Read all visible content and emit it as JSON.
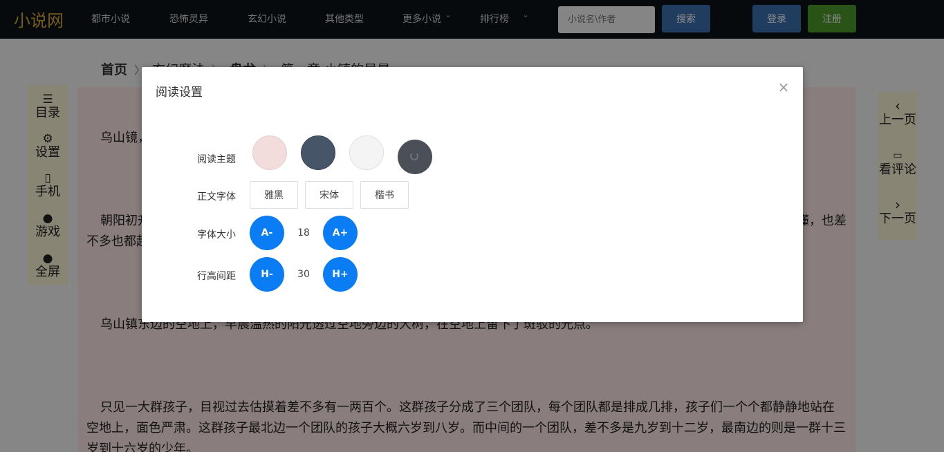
{
  "nav": {
    "logo": "小说网",
    "items": [
      "都市小说",
      "恐怖灵异",
      "玄幻小说",
      "其他类型",
      "更多小说",
      "排行榜"
    ],
    "search_placeholder": "小说名\\作者",
    "search_label": "搜索",
    "login_label": "登录",
    "register_label": "注册"
  },
  "breadcrumb": [
    "首页",
    "玄幻魔法",
    "盘龙",
    "第一章 小镇的早晨"
  ],
  "left_tools": [
    {
      "icon": "list-icon",
      "label": "目录"
    },
    {
      "icon": "gear-icon",
      "label": "设置"
    },
    {
      "icon": "phone-icon",
      "label": "手机"
    },
    {
      "icon": "gamepad-icon",
      "label": "游戏"
    },
    {
      "icon": "fullscreen-icon",
      "label": "全屏"
    }
  ],
  "right_tools": [
    {
      "icon": "chevron-left-icon",
      "label": "上一页"
    },
    {
      "icon": "comment-icon",
      "label": "看评论"
    },
    {
      "icon": "chevron-right-icon",
      "label": "下一页"
    }
  ],
  "content": {
    "p1": "乌山镜，",
    "p2_line1": "朝阳初升",
    "p2_tail": "懂，也差",
    "p2_line2": "不多也都起",
    "p3": "乌山镇东边的空地上，早晨温热的阳光透过空地旁边的大树，在空地上留下了斑驳的光点。",
    "p4": "只见一大群孩子，目视过去估摸着差不多有一两百个。这群孩子分成了三个团队，每个团队都是排成几排，孩子们一个个都静静地站在空地上，面色严肃。这群孩子最北边一个团队的孩子大概六岁到八岁。而中间的一个团队，差不多是九岁到十二岁，最南边的则是一群十三岁到十六岁的少年。"
  },
  "modal": {
    "title": "阅读设置",
    "theme_label": "阅读主题",
    "font_label": "正文字体",
    "size_label": "字体大小",
    "lineheight_label": "行高间距",
    "themes": [
      "#f3dcdc",
      "#475569",
      "#f4f4f4",
      "#4a4f58"
    ],
    "fonts": [
      "雅黑",
      "宋体",
      "楷书"
    ],
    "size_minus": "A-",
    "size_value": "18",
    "size_plus": "A+",
    "lh_minus": "H-",
    "lh_value": "30",
    "lh_plus": "H+"
  }
}
